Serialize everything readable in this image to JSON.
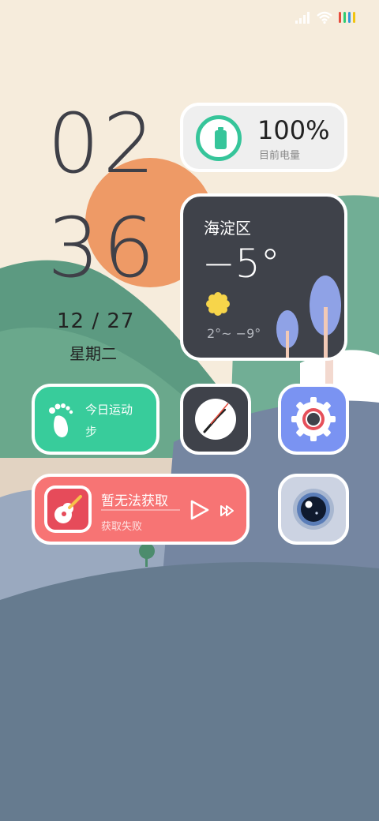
{
  "status_bar": {
    "icons": [
      "signal-icon",
      "wifi-icon",
      "color-bars-icon"
    ],
    "bar_colors": [
      "#e74c3c",
      "#2ecc71",
      "#3498db",
      "#f1c40f"
    ]
  },
  "clock": {
    "hours": "02",
    "minutes": "36",
    "date": "12 / 27",
    "weekday": "星期二"
  },
  "battery": {
    "percent": "100%",
    "label": "目前电量",
    "accent": "#36c59a"
  },
  "weather": {
    "city": "海淀区",
    "temp": "−5°",
    "range": "2°~ −9°",
    "icon": "sun-icon"
  },
  "steps": {
    "title": "今日运动",
    "value": "步",
    "icon": "footprint-icon"
  },
  "music": {
    "song": "暂无法获取",
    "status": "获取失败",
    "icons": [
      "guitar-icon",
      "play-icon",
      "skip-forward-icon"
    ]
  },
  "apps": [
    {
      "name": "clock-app",
      "icon": "clock-icon"
    },
    {
      "name": "settings-app",
      "icon": "gear-icon"
    },
    {
      "name": "camera-app",
      "icon": "camera-lens-icon"
    }
  ]
}
